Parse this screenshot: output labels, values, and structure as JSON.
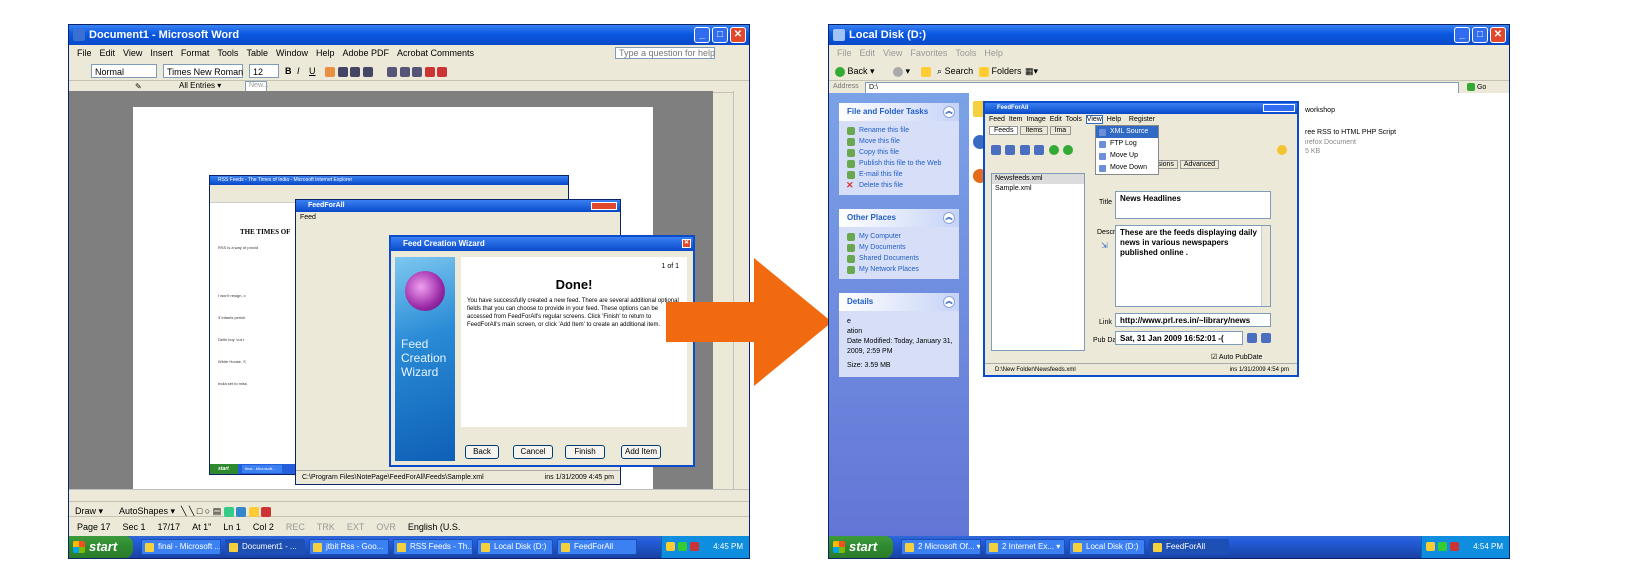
{
  "left": {
    "window_title": "Document1 - Microsoft Word",
    "menus": [
      "File",
      "Edit",
      "View",
      "Insert",
      "Format",
      "Tools",
      "Table",
      "Window",
      "Help",
      "Adobe PDF",
      "Acrobat Comments"
    ],
    "help_box": "Type a question for help",
    "style": "Normal",
    "font": "Times New Roman",
    "size": "12",
    "autotext": "All Entries ▾",
    "autotext_new": "New...",
    "nested": {
      "ie_title": "RSS Feeds - The Times of India - Microsoft Internet Explorer",
      "times_heading": "THE TIMES OF",
      "snippets": [
        "RSS is a way of provid",
        "I won't resign, c",
        "3 Infants perish",
        "Delhi boy 'cut t",
        "White House, S",
        "India set to miss"
      ],
      "ffa_title": "FeedForAll",
      "ffa_menu": "Feed",
      "wizard_title": "Feed Creation Wizard",
      "wizard_side_text": "Feed Creation Wizard",
      "page_counter": "1 of 1",
      "done_heading": "Done!",
      "done_text": "You have successfully created a new feed. There are several additional optional fields that you can choose to provide in your feed. These options can be accessed from FeedForAll's regular screens. Click 'Finish' to return to FeedForAll's main screen, or click 'Add Item' to create an additional item.",
      "buttons": [
        "Back",
        "Cancel",
        "Finish",
        "Add Item"
      ],
      "status_path": "C:\\Program Files\\NotePage\\FeedForAll\\Feeds\\Sample.xml",
      "status_ins": "ins 1/31/2009 4:45 pm",
      "mini_start": "start",
      "mini_task": "final - Microsoft..."
    },
    "draw_toolbar": "Draw ▾",
    "autoshapes": "AutoShapes ▾",
    "status": [
      "Page 17",
      "Sec 1",
      "17/17",
      "At 1\"",
      "Ln 1",
      "Col 2",
      "REC",
      "TRK",
      "EXT",
      "OVR",
      "English (U.S."
    ],
    "taskbar": {
      "start": "start",
      "buttons": [
        "final - Microsoft ...",
        "Document1 - ...",
        "jtbit Rss - Goo...",
        "RSS Feeds - Th...",
        "Local Disk (D:)",
        "FeedForAll"
      ],
      "clock": "4:45 PM"
    }
  },
  "right": {
    "window_title": "Local Disk (D:)",
    "menus": [
      "File",
      "Edit",
      "View",
      "Favorites",
      "Tools",
      "Help"
    ],
    "toolbar": [
      "Back",
      "Search",
      "Folders"
    ],
    "address_label": "Address",
    "address": "D:\\",
    "go": "Go",
    "file_tasks_title": "File and Folder Tasks",
    "file_tasks": [
      "Rename this file",
      "Move this file",
      "Copy this file",
      "Publish this file to the Web",
      "E-mail this file",
      "Delete this file"
    ],
    "other_places_title": "Other Places",
    "other_places": [
      "My Computer",
      "My Documents",
      "Shared Documents",
      "My Network Places"
    ],
    "details_title": "Details",
    "details": [
      "Date Modified: Today, January 31, 2009, 2:59 PM",
      "Size: 3.59 MB"
    ],
    "details_partial": [
      "e",
      "ation"
    ],
    "folder_items": [
      "workshop",
      "ree RSS to HTML PHP Script",
      "irefox Document",
      "5 KB"
    ],
    "ffa": {
      "title": "FeedForAll",
      "menus": [
        "Feed",
        "Item",
        "Image",
        "Edit",
        "Tools",
        "View",
        "Help",
        "Register"
      ],
      "tabs": [
        "Feeds",
        "Items",
        "Ima"
      ],
      "view_menu": [
        "XML Source",
        "FTP Log",
        "Move Up",
        "Move Down"
      ],
      "subtabs": [
        "tional",
        "Extensions",
        "Advanced"
      ],
      "feeds": [
        "Newsfeeds.xml",
        "Sample.xml"
      ],
      "title_label": "Title",
      "title_value": "News Headlines",
      "desc_label": "Descriptic",
      "desc_value": "These are the feeds displaying daily news in various newspapers published online .",
      "link_label": "Link",
      "link_value": "http://www.prl.res.in/~library/news",
      "pubdate_label": "Pub Date",
      "pubdate_value": "Sat, 31 Jan 2009 16:52:01 -(",
      "auto_pubdate": "Auto PubDate",
      "status_path": "D:\\New Folder\\Newsfeeds.xml",
      "status_ins": "ins 1/31/2009 4:54 pm"
    },
    "taskbar": {
      "start": "start",
      "buttons": [
        "2 Microsoft Of... ▾",
        "2 Internet Ex... ▾",
        "Local Disk (D:)",
        "FeedForAll"
      ],
      "clock": "4:54 PM"
    }
  },
  "colors": {
    "arrow": "#f26a10",
    "xp_blue": "#0a58e0",
    "taskbar": "#245edb",
    "start_green": "#2f8a2f"
  }
}
